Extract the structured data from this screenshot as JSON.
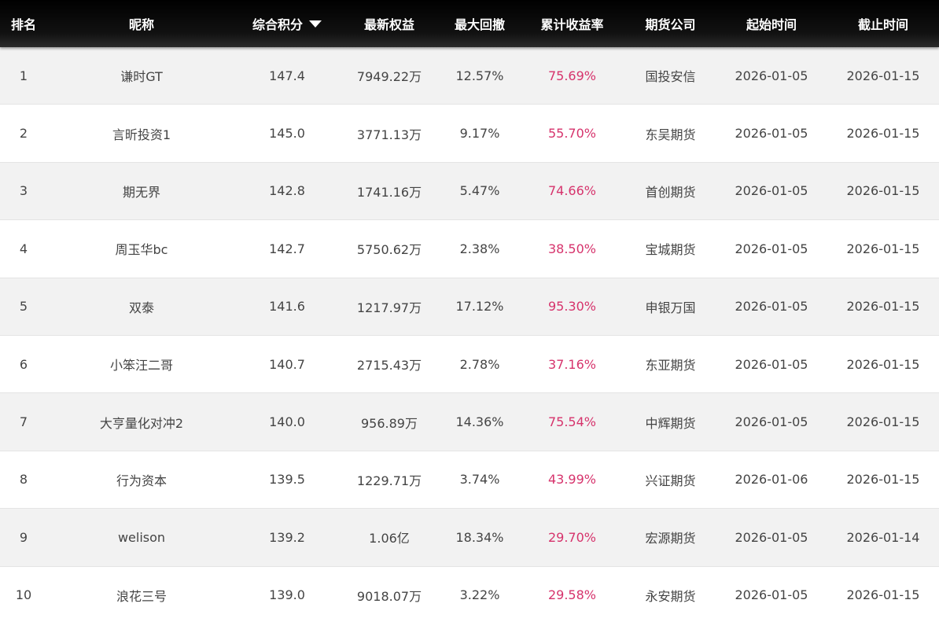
{
  "headers": {
    "rank": "排名",
    "nickname": "昵称",
    "score": "综合积分",
    "equity": "最新权益",
    "drawdown": "最大回撤",
    "return_rate": "累计收益率",
    "company": "期货公司",
    "start": "起始时间",
    "end": "截止时间"
  },
  "sort": {
    "column": "score",
    "direction": "desc",
    "icon": "sort-down-icon"
  },
  "colors": {
    "header_bg": "#000000",
    "rate_color": "#d6336c",
    "row_alt": "#f2f2f2"
  },
  "rows": [
    {
      "rank": "1",
      "nickname": "谦时GT",
      "score": "147.4",
      "equity": "7949.22万",
      "drawdown": "12.57%",
      "return_rate": "75.69%",
      "company": "国投安信",
      "start": "2026-01-05",
      "end": "2026-01-15"
    },
    {
      "rank": "2",
      "nickname": "言昕投资1",
      "score": "145.0",
      "equity": "3771.13万",
      "drawdown": "9.17%",
      "return_rate": "55.70%",
      "company": "东吴期货",
      "start": "2026-01-05",
      "end": "2026-01-15"
    },
    {
      "rank": "3",
      "nickname": "期无界",
      "score": "142.8",
      "equity": "1741.16万",
      "drawdown": "5.47%",
      "return_rate": "74.66%",
      "company": "首创期货",
      "start": "2026-01-05",
      "end": "2026-01-15"
    },
    {
      "rank": "4",
      "nickname": "周玉华bc",
      "score": "142.7",
      "equity": "5750.62万",
      "drawdown": "2.38%",
      "return_rate": "38.50%",
      "company": "宝城期货",
      "start": "2026-01-05",
      "end": "2026-01-15"
    },
    {
      "rank": "5",
      "nickname": "双泰",
      "score": "141.6",
      "equity": "1217.97万",
      "drawdown": "17.12%",
      "return_rate": "95.30%",
      "company": "申银万国",
      "start": "2026-01-05",
      "end": "2026-01-15"
    },
    {
      "rank": "6",
      "nickname": "小笨汪二哥",
      "score": "140.7",
      "equity": "2715.43万",
      "drawdown": "2.78%",
      "return_rate": "37.16%",
      "company": "东亚期货",
      "start": "2026-01-05",
      "end": "2026-01-15"
    },
    {
      "rank": "7",
      "nickname": "大亨量化对冲2",
      "score": "140.0",
      "equity": "956.89万",
      "drawdown": "14.36%",
      "return_rate": "75.54%",
      "company": "中辉期货",
      "start": "2026-01-05",
      "end": "2026-01-15"
    },
    {
      "rank": "8",
      "nickname": "行为资本",
      "score": "139.5",
      "equity": "1229.71万",
      "drawdown": "3.74%",
      "return_rate": "43.99%",
      "company": "兴证期货",
      "start": "2026-01-06",
      "end": "2026-01-15"
    },
    {
      "rank": "9",
      "nickname": "welison",
      "score": "139.2",
      "equity": "1.06亿",
      "drawdown": "18.34%",
      "return_rate": "29.70%",
      "company": "宏源期货",
      "start": "2026-01-05",
      "end": "2026-01-14"
    },
    {
      "rank": "10",
      "nickname": "浪花三号",
      "score": "139.0",
      "equity": "9018.07万",
      "drawdown": "3.22%",
      "return_rate": "29.58%",
      "company": "永安期货",
      "start": "2026-01-05",
      "end": "2026-01-15"
    }
  ]
}
